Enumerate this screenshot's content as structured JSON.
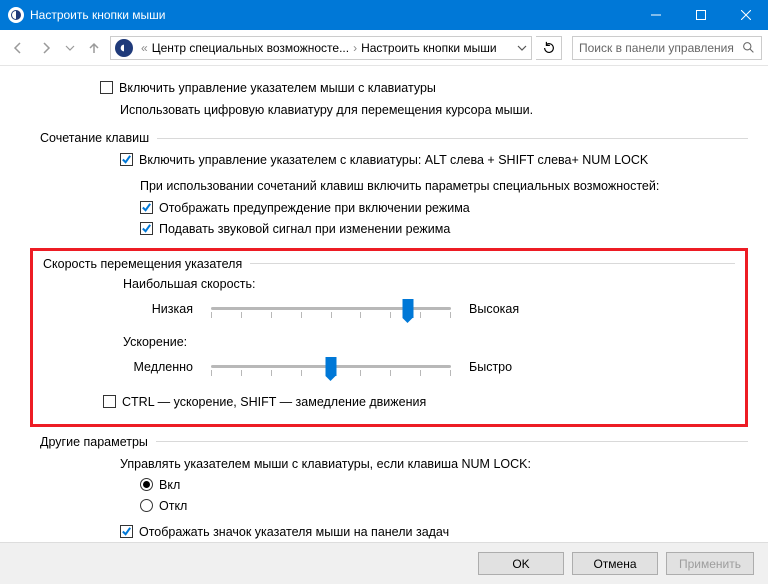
{
  "window": {
    "title": "Настроить кнопки мыши"
  },
  "breadcrumb": {
    "item1": "Центр специальных возможносте...",
    "item2": "Настроить кнопки мыши"
  },
  "search": {
    "placeholder": "Поиск в панели управления"
  },
  "main": {
    "enable_keyboard": "Включить управление указателем мыши с клавиатуры",
    "description": "Использовать цифровую клавиатуру для перемещения курсора мыши."
  },
  "hotkeys": {
    "title": "Сочетание клавиш",
    "enable": "Включить управление указателем с клавиатуры: ALT слева + SHIFT слева+ NUM LOCK",
    "sub_desc": "При использовании сочетаний клавиш включить параметры специальных возможностей:",
    "warn": "Отображать предупреждение при включении режима",
    "sound": "Подавать звуковой сигнал при изменении режима"
  },
  "speed": {
    "title": "Скорость перемещения указателя",
    "max_label": "Наибольшая скорость:",
    "low": "Низкая",
    "high": "Высокая",
    "accel_label": "Ускорение:",
    "slow": "Медленно",
    "fast": "Быстро",
    "ctrl_shift": "CTRL — ускорение, SHIFT — замедление движения"
  },
  "other": {
    "title": "Другие параметры",
    "numlock": "Управлять указателем мыши с клавиатуры, если клавиша NUM LOCK:",
    "on": "Вкл",
    "off": "Откл",
    "tray": "Отображать значок указателя мыши на панели задач"
  },
  "footer": {
    "ok": "OK",
    "cancel": "Отмена",
    "apply": "Применить"
  }
}
